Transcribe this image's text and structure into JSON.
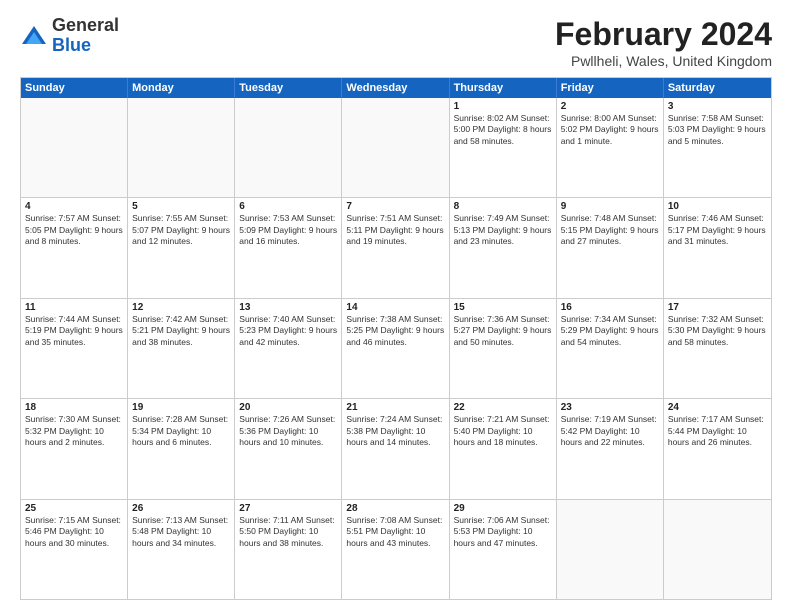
{
  "header": {
    "logo_general": "General",
    "logo_blue": "Blue",
    "month": "February 2024",
    "location": "Pwllheli, Wales, United Kingdom"
  },
  "days_of_week": [
    "Sunday",
    "Monday",
    "Tuesday",
    "Wednesday",
    "Thursday",
    "Friday",
    "Saturday"
  ],
  "weeks": [
    [
      {
        "day": "",
        "text": "",
        "empty": true
      },
      {
        "day": "",
        "text": "",
        "empty": true
      },
      {
        "day": "",
        "text": "",
        "empty": true
      },
      {
        "day": "",
        "text": "",
        "empty": true
      },
      {
        "day": "1",
        "text": "Sunrise: 8:02 AM\nSunset: 5:00 PM\nDaylight: 8 hours\nand 58 minutes."
      },
      {
        "day": "2",
        "text": "Sunrise: 8:00 AM\nSunset: 5:02 PM\nDaylight: 9 hours\nand 1 minute."
      },
      {
        "day": "3",
        "text": "Sunrise: 7:58 AM\nSunset: 5:03 PM\nDaylight: 9 hours\nand 5 minutes."
      }
    ],
    [
      {
        "day": "4",
        "text": "Sunrise: 7:57 AM\nSunset: 5:05 PM\nDaylight: 9 hours\nand 8 minutes."
      },
      {
        "day": "5",
        "text": "Sunrise: 7:55 AM\nSunset: 5:07 PM\nDaylight: 9 hours\nand 12 minutes."
      },
      {
        "day": "6",
        "text": "Sunrise: 7:53 AM\nSunset: 5:09 PM\nDaylight: 9 hours\nand 16 minutes."
      },
      {
        "day": "7",
        "text": "Sunrise: 7:51 AM\nSunset: 5:11 PM\nDaylight: 9 hours\nand 19 minutes."
      },
      {
        "day": "8",
        "text": "Sunrise: 7:49 AM\nSunset: 5:13 PM\nDaylight: 9 hours\nand 23 minutes."
      },
      {
        "day": "9",
        "text": "Sunrise: 7:48 AM\nSunset: 5:15 PM\nDaylight: 9 hours\nand 27 minutes."
      },
      {
        "day": "10",
        "text": "Sunrise: 7:46 AM\nSunset: 5:17 PM\nDaylight: 9 hours\nand 31 minutes."
      }
    ],
    [
      {
        "day": "11",
        "text": "Sunrise: 7:44 AM\nSunset: 5:19 PM\nDaylight: 9 hours\nand 35 minutes."
      },
      {
        "day": "12",
        "text": "Sunrise: 7:42 AM\nSunset: 5:21 PM\nDaylight: 9 hours\nand 38 minutes."
      },
      {
        "day": "13",
        "text": "Sunrise: 7:40 AM\nSunset: 5:23 PM\nDaylight: 9 hours\nand 42 minutes."
      },
      {
        "day": "14",
        "text": "Sunrise: 7:38 AM\nSunset: 5:25 PM\nDaylight: 9 hours\nand 46 minutes."
      },
      {
        "day": "15",
        "text": "Sunrise: 7:36 AM\nSunset: 5:27 PM\nDaylight: 9 hours\nand 50 minutes."
      },
      {
        "day": "16",
        "text": "Sunrise: 7:34 AM\nSunset: 5:29 PM\nDaylight: 9 hours\nand 54 minutes."
      },
      {
        "day": "17",
        "text": "Sunrise: 7:32 AM\nSunset: 5:30 PM\nDaylight: 9 hours\nand 58 minutes."
      }
    ],
    [
      {
        "day": "18",
        "text": "Sunrise: 7:30 AM\nSunset: 5:32 PM\nDaylight: 10 hours\nand 2 minutes."
      },
      {
        "day": "19",
        "text": "Sunrise: 7:28 AM\nSunset: 5:34 PM\nDaylight: 10 hours\nand 6 minutes."
      },
      {
        "day": "20",
        "text": "Sunrise: 7:26 AM\nSunset: 5:36 PM\nDaylight: 10 hours\nand 10 minutes."
      },
      {
        "day": "21",
        "text": "Sunrise: 7:24 AM\nSunset: 5:38 PM\nDaylight: 10 hours\nand 14 minutes."
      },
      {
        "day": "22",
        "text": "Sunrise: 7:21 AM\nSunset: 5:40 PM\nDaylight: 10 hours\nand 18 minutes."
      },
      {
        "day": "23",
        "text": "Sunrise: 7:19 AM\nSunset: 5:42 PM\nDaylight: 10 hours\nand 22 minutes."
      },
      {
        "day": "24",
        "text": "Sunrise: 7:17 AM\nSunset: 5:44 PM\nDaylight: 10 hours\nand 26 minutes."
      }
    ],
    [
      {
        "day": "25",
        "text": "Sunrise: 7:15 AM\nSunset: 5:46 PM\nDaylight: 10 hours\nand 30 minutes."
      },
      {
        "day": "26",
        "text": "Sunrise: 7:13 AM\nSunset: 5:48 PM\nDaylight: 10 hours\nand 34 minutes."
      },
      {
        "day": "27",
        "text": "Sunrise: 7:11 AM\nSunset: 5:50 PM\nDaylight: 10 hours\nand 38 minutes."
      },
      {
        "day": "28",
        "text": "Sunrise: 7:08 AM\nSunset: 5:51 PM\nDaylight: 10 hours\nand 43 minutes."
      },
      {
        "day": "29",
        "text": "Sunrise: 7:06 AM\nSunset: 5:53 PM\nDaylight: 10 hours\nand 47 minutes."
      },
      {
        "day": "",
        "text": "",
        "empty": true
      },
      {
        "day": "",
        "text": "",
        "empty": true
      }
    ]
  ]
}
